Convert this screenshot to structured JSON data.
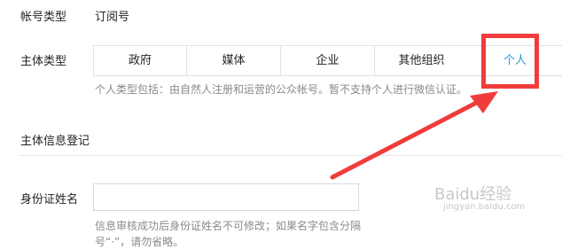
{
  "account_type": {
    "label": "帐号类型",
    "value": "订阅号"
  },
  "subject_type": {
    "label": "主体类型",
    "options": [
      "政府",
      "媒体",
      "企业",
      "其他组织",
      "个人"
    ],
    "selected": "个人",
    "hint": "个人类型包括：由自然人注册和运营的公众帐号。暂不支持个人进行微信认证。"
  },
  "section_title": "主体信息登记",
  "id_name": {
    "label": "身份证姓名",
    "value": "",
    "hint_line1": "信息审核成功后身份证姓名不可修改；如果名字包含分隔",
    "hint_line2": "号“·”，请勿省略。"
  },
  "watermark": {
    "text": "Baidu经验",
    "sub": "jingyan.baidu.com"
  },
  "colors": {
    "accent": "#2a9ad8",
    "annotation": "#f03c3c",
    "border": "#e1e1e1",
    "hint": "#8a8a8a"
  }
}
